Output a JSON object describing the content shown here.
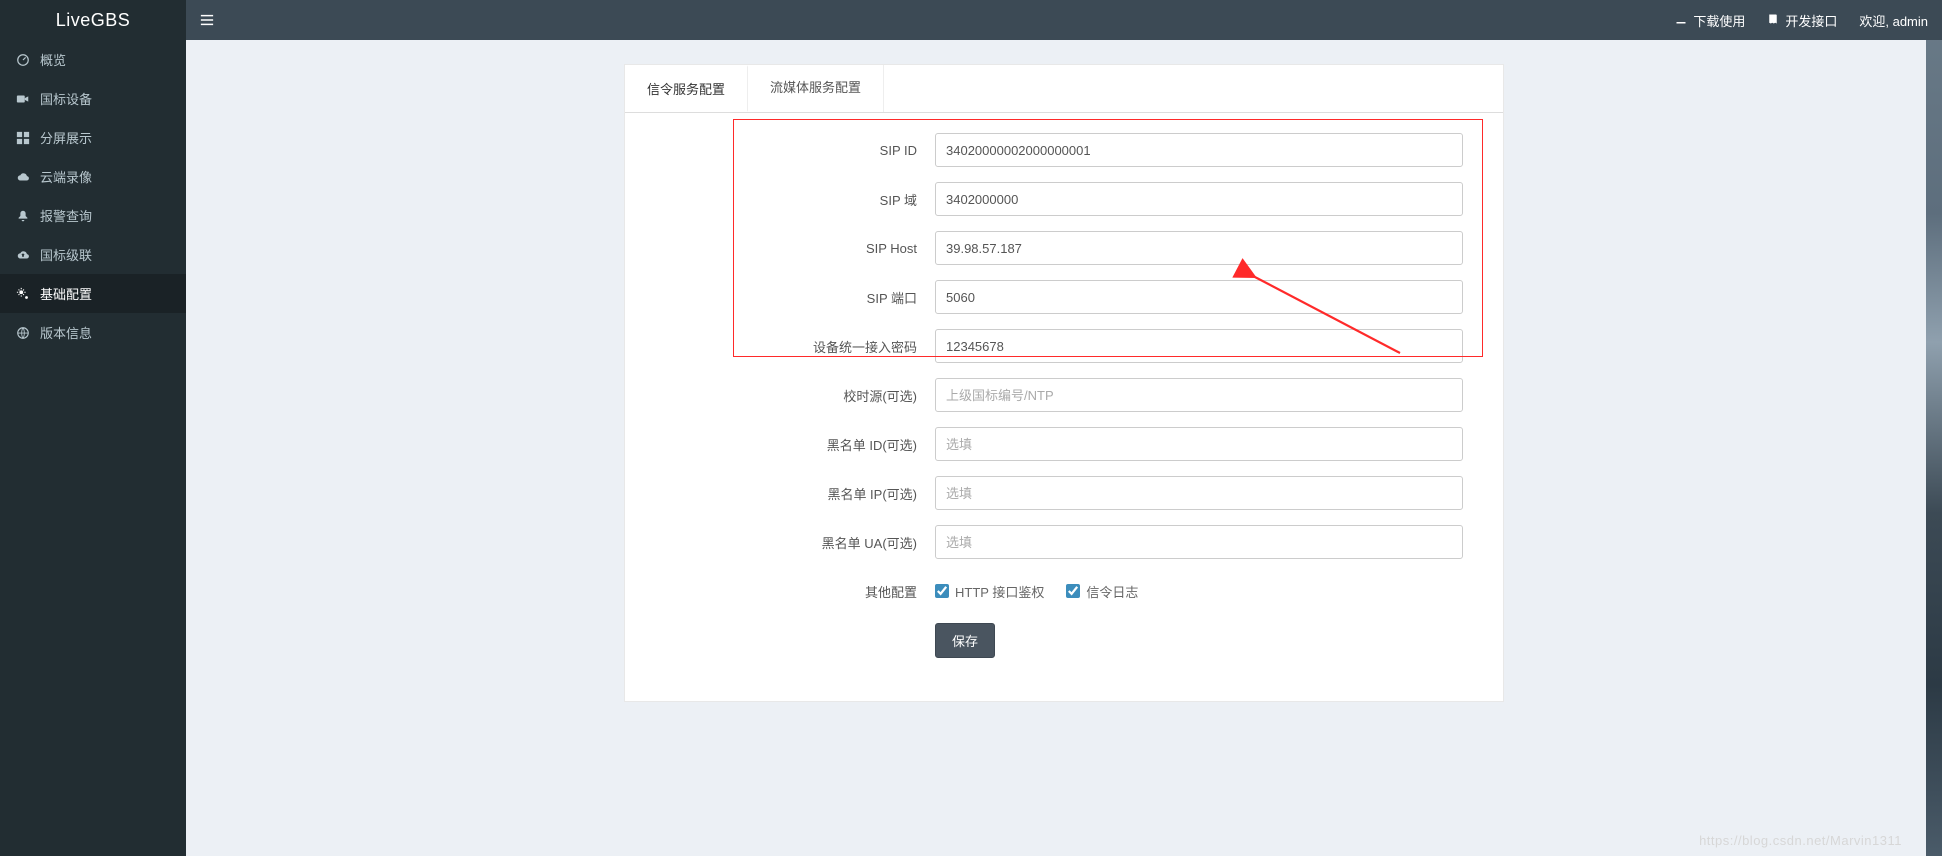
{
  "app_title": "LiveGBS",
  "topbar": {
    "download": "下载使用",
    "api": "开发接口",
    "welcome": "欢迎, admin"
  },
  "sidebar": {
    "items": [
      {
        "label": "概览"
      },
      {
        "label": "国标设备"
      },
      {
        "label": "分屏展示"
      },
      {
        "label": "云端录像"
      },
      {
        "label": "报警查询"
      },
      {
        "label": "国标级联"
      },
      {
        "label": "基础配置"
      },
      {
        "label": "版本信息"
      }
    ]
  },
  "tabs": {
    "t0": "信令服务配置",
    "t1": "流媒体服务配置"
  },
  "form": {
    "sip_id": {
      "label": "SIP ID",
      "value": "34020000002000000001"
    },
    "sip_domain": {
      "label": "SIP 域",
      "value": "3402000000"
    },
    "sip_host": {
      "label": "SIP Host",
      "value": "39.98.57.187"
    },
    "sip_port": {
      "label": "SIP 端口",
      "value": "5060"
    },
    "device_pwd": {
      "label": "设备统一接入密码",
      "value": "12345678"
    },
    "time_src": {
      "label": "校时源(可选)",
      "value": "",
      "placeholder": "上级国标编号/NTP"
    },
    "blacklist_id": {
      "label": "黑名单 ID(可选)",
      "value": "",
      "placeholder": "选填"
    },
    "blacklist_ip": {
      "label": "黑名单 IP(可选)",
      "value": "",
      "placeholder": "选填"
    },
    "blacklist_ua": {
      "label": "黑名单 UA(可选)",
      "value": "",
      "placeholder": "选填"
    },
    "other": {
      "label": "其他配置",
      "opt1": "HTTP 接口鉴权",
      "opt2": "信令日志"
    },
    "save": "保存"
  },
  "watermark": "https://blog.csdn.net/Marvin1311"
}
